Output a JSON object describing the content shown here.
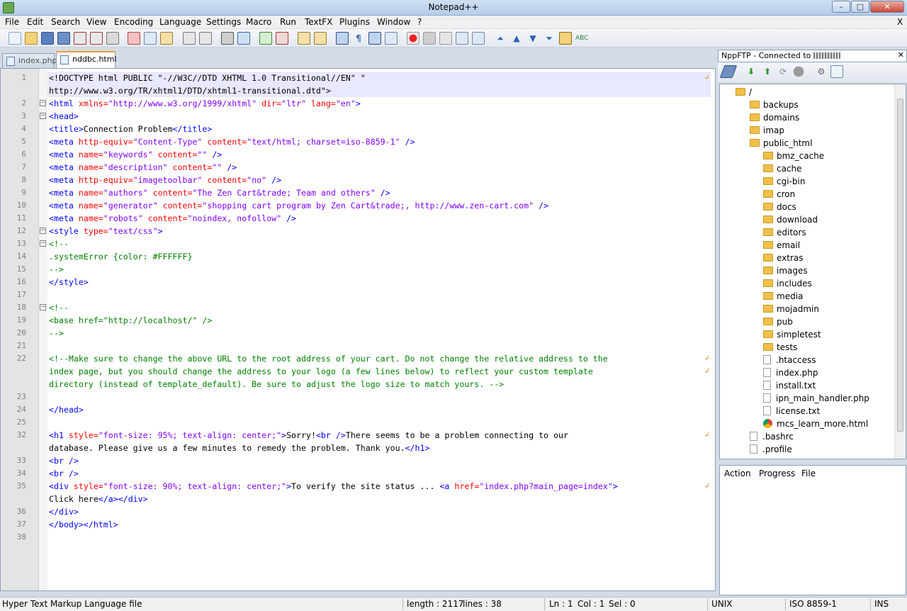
{
  "window": {
    "title": "Notepad++",
    "close_label": "X"
  },
  "menu": [
    "File",
    "Edit",
    "Search",
    "View",
    "Encoding",
    "Language",
    "Settings",
    "Macro",
    "Run",
    "TextFX",
    "Plugins",
    "Window",
    "?"
  ],
  "tabs": [
    {
      "label": "index.php",
      "active": false
    },
    {
      "label": "nddbc.html",
      "active": true
    }
  ],
  "lines": [
    {
      "num": "1",
      "rows": 2,
      "fold": "",
      "segs": [
        [
          "d",
          "<!DOCTYPE html PUBLIC \"-//W3C//DTD XHTML 1.0 Transitional//EN\" \""
        ],
        [
          "d",
          "http://www.w3.org/TR/xhtml1/DTD/xhtml1-transitional.dtd\">"
        ]
      ]
    },
    {
      "num": "2",
      "rows": 1,
      "fold": "-",
      "segs": [
        [
          "t",
          "<html "
        ],
        [
          "a",
          "xmlns="
        ],
        [
          "v",
          "\"http://www.w3.org/1999/xhtml\" "
        ],
        [
          "a",
          "dir="
        ],
        [
          "v",
          "\"ltr\" "
        ],
        [
          "a",
          "lang="
        ],
        [
          "v",
          "\"en\""
        ],
        [
          "t",
          ">"
        ]
      ]
    },
    {
      "num": "3",
      "rows": 1,
      "fold": "-",
      "segs": [
        [
          "t",
          "<head>"
        ]
      ]
    },
    {
      "num": "4",
      "rows": 1,
      "fold": "",
      "segs": [
        [
          "t",
          "<title>"
        ],
        [
          "d",
          "Connection Problem"
        ],
        [
          "t",
          "</title>"
        ]
      ]
    },
    {
      "num": "5",
      "rows": 1,
      "fold": "",
      "segs": [
        [
          "t",
          "<meta "
        ],
        [
          "a",
          "http-equiv="
        ],
        [
          "v",
          "\"Content-Type\" "
        ],
        [
          "a",
          "content="
        ],
        [
          "v",
          "\"text/html; charset=iso-8859-1\" "
        ],
        [
          "t",
          "/>"
        ]
      ]
    },
    {
      "num": "6",
      "rows": 1,
      "fold": "",
      "segs": [
        [
          "t",
          "<meta "
        ],
        [
          "a",
          "name="
        ],
        [
          "v",
          "\"keywords\" "
        ],
        [
          "a",
          "content="
        ],
        [
          "v",
          "\"\" "
        ],
        [
          "t",
          "/>"
        ]
      ]
    },
    {
      "num": "7",
      "rows": 1,
      "fold": "",
      "segs": [
        [
          "t",
          "<meta "
        ],
        [
          "a",
          "name="
        ],
        [
          "v",
          "\"description\" "
        ],
        [
          "a",
          "content="
        ],
        [
          "v",
          "\"\" "
        ],
        [
          "t",
          "/>"
        ]
      ]
    },
    {
      "num": "8",
      "rows": 1,
      "fold": "",
      "segs": [
        [
          "t",
          "<meta "
        ],
        [
          "a",
          "http-equiv="
        ],
        [
          "v",
          "\"imagetoolbar\" "
        ],
        [
          "a",
          "content="
        ],
        [
          "v",
          "\"no\" "
        ],
        [
          "t",
          "/>"
        ]
      ]
    },
    {
      "num": "9",
      "rows": 1,
      "fold": "",
      "segs": [
        [
          "t",
          "<meta "
        ],
        [
          "a",
          "name="
        ],
        [
          "v",
          "\"authors\" "
        ],
        [
          "a",
          "content="
        ],
        [
          "v",
          "\"The Zen Cart&trade; Team and others\" "
        ],
        [
          "t",
          "/>"
        ]
      ]
    },
    {
      "num": "10",
      "rows": 1,
      "fold": "",
      "segs": [
        [
          "t",
          "<meta "
        ],
        [
          "a",
          "name="
        ],
        [
          "v",
          "\"generator\" "
        ],
        [
          "a",
          "content="
        ],
        [
          "v",
          "\"shopping cart program by Zen Cart&trade;, http://www.zen-cart.com\" "
        ],
        [
          "t",
          "/>"
        ]
      ]
    },
    {
      "num": "11",
      "rows": 1,
      "fold": "",
      "segs": [
        [
          "t",
          "<meta "
        ],
        [
          "a",
          "name="
        ],
        [
          "v",
          "\"robots\" "
        ],
        [
          "a",
          "content="
        ],
        [
          "v",
          "\"noindex, nofollow\" "
        ],
        [
          "t",
          "/>"
        ]
      ]
    },
    {
      "num": "12",
      "rows": 1,
      "fold": "-",
      "segs": [
        [
          "t",
          "<style "
        ],
        [
          "a",
          "type="
        ],
        [
          "v",
          "\"text/css\""
        ],
        [
          "t",
          ">"
        ]
      ]
    },
    {
      "num": "13",
      "rows": 1,
      "fold": "-",
      "segs": [
        [
          "c",
          "<!--"
        ]
      ]
    },
    {
      "num": "14",
      "rows": 1,
      "fold": "",
      "segs": [
        [
          "c",
          ".systemError {color: #FFFFFF}"
        ]
      ]
    },
    {
      "num": "15",
      "rows": 1,
      "fold": "",
      "segs": [
        [
          "c",
          "-->"
        ]
      ]
    },
    {
      "num": "16",
      "rows": 1,
      "fold": "",
      "segs": [
        [
          "t",
          "</style>"
        ]
      ]
    },
    {
      "num": "17",
      "rows": 1,
      "fold": "",
      "segs": []
    },
    {
      "num": "18",
      "rows": 1,
      "fold": "-",
      "segs": [
        [
          "c",
          "<!--"
        ]
      ]
    },
    {
      "num": "19",
      "rows": 1,
      "fold": "",
      "segs": [
        [
          "c",
          "<base href=\"http://localhost/\" />"
        ]
      ]
    },
    {
      "num": "20",
      "rows": 1,
      "fold": "",
      "segs": [
        [
          "c",
          "-->"
        ]
      ]
    },
    {
      "num": "21",
      "rows": 1,
      "fold": "",
      "segs": []
    },
    {
      "num": "22",
      "rows": 3,
      "fold": "",
      "segs": [
        [
          "c",
          "<!--Make sure to change the above URL to the root address of your cart. Do not change the relative address to the"
        ],
        [
          "c",
          "index page, but you should change the address to your logo (a few lines below) to reflect your custom template"
        ],
        [
          "c",
          "directory (instead of template_default). Be sure to adjust the logo size to match yours. -->"
        ]
      ]
    },
    {
      "num": "23",
      "rows": 1,
      "fold": "",
      "segs": []
    },
    {
      "num": "24",
      "rows": 1,
      "fold": "",
      "segs": [
        [
          "t",
          "</head>"
        ]
      ]
    },
    {
      "num": "25",
      "rows": 1,
      "fold": "",
      "segs": []
    },
    {
      "num": "32",
      "rows": 2,
      "fold": "",
      "segs": [
        [
          "t",
          "<h1 "
        ],
        [
          "a",
          "style="
        ],
        [
          "v",
          "\"font-size: 95%; text-align: center;\""
        ],
        [
          "t",
          ">"
        ],
        [
          "d",
          "Sorry!"
        ],
        [
          "t",
          "<br />"
        ],
        [
          "d",
          "There seems to be a problem connecting to our"
        ],
        [
          "d",
          "database. Please give us a few minutes to remedy the problem. Thank you."
        ],
        [
          "t",
          "</h1>"
        ]
      ]
    },
    {
      "num": "33",
      "rows": 1,
      "fold": "",
      "segs": [
        [
          "t",
          "<br />"
        ]
      ]
    },
    {
      "num": "34",
      "rows": 1,
      "fold": "",
      "segs": [
        [
          "t",
          "<br />"
        ]
      ]
    },
    {
      "num": "35",
      "rows": 2,
      "fold": "",
      "segs": [
        [
          "t",
          "<div "
        ],
        [
          "a",
          "style="
        ],
        [
          "v",
          "\"font-size: 90%; text-align: center;\""
        ],
        [
          "t",
          ">"
        ],
        [
          "d",
          "To verify the site status ... "
        ],
        [
          "t",
          "<a "
        ],
        [
          "a",
          "href="
        ],
        [
          "v",
          "\"index.php?main_page=index\""
        ],
        [
          "t",
          ">"
        ],
        [
          "d",
          "Click here"
        ],
        [
          "t",
          "</a></div>"
        ]
      ]
    },
    {
      "num": "36",
      "rows": 1,
      "fold": "",
      "segs": [
        [
          "t",
          "</div>"
        ]
      ]
    },
    {
      "num": "37",
      "rows": 1,
      "fold": "",
      "segs": [
        [
          "t",
          "</body></html>"
        ]
      ]
    },
    {
      "num": "38",
      "rows": 1,
      "fold": "",
      "segs": []
    }
  ],
  "ftp": {
    "header": "NppFTP - Connected to",
    "tree": [
      {
        "label": "/",
        "kind": "folder",
        "depth": 0
      },
      {
        "label": "backups",
        "kind": "folder",
        "depth": 1
      },
      {
        "label": "domains",
        "kind": "folder",
        "depth": 1
      },
      {
        "label": "imap",
        "kind": "folder",
        "depth": 1
      },
      {
        "label": "public_html",
        "kind": "folder",
        "depth": 1
      },
      {
        "label": "bmz_cache",
        "kind": "folder",
        "depth": 2
      },
      {
        "label": "cache",
        "kind": "folder",
        "depth": 2
      },
      {
        "label": "cgi-bin",
        "kind": "folder",
        "depth": 2
      },
      {
        "label": "cron",
        "kind": "folder",
        "depth": 2
      },
      {
        "label": "docs",
        "kind": "folder",
        "depth": 2
      },
      {
        "label": "download",
        "kind": "folder",
        "depth": 2
      },
      {
        "label": "editors",
        "kind": "folder",
        "depth": 2
      },
      {
        "label": "email",
        "kind": "folder",
        "depth": 2
      },
      {
        "label": "extras",
        "kind": "folder",
        "depth": 2
      },
      {
        "label": "images",
        "kind": "folder",
        "depth": 2
      },
      {
        "label": "includes",
        "kind": "folder",
        "depth": 2
      },
      {
        "label": "media",
        "kind": "folder",
        "depth": 2
      },
      {
        "label": "mojadmin",
        "kind": "folder",
        "depth": 2
      },
      {
        "label": "pub",
        "kind": "folder",
        "depth": 2
      },
      {
        "label": "simpletest",
        "kind": "folder",
        "depth": 2
      },
      {
        "label": "tests",
        "kind": "folder",
        "depth": 2
      },
      {
        "label": ".htaccess",
        "kind": "file",
        "depth": 2
      },
      {
        "label": "index.php",
        "kind": "file",
        "depth": 2
      },
      {
        "label": "install.txt",
        "kind": "file",
        "depth": 2
      },
      {
        "label": "ipn_main_handler.php",
        "kind": "file",
        "depth": 2
      },
      {
        "label": "license.txt",
        "kind": "file",
        "depth": 2
      },
      {
        "label": "mcs_learn_more.html",
        "kind": "chrome",
        "depth": 2
      },
      {
        "label": ".bashrc",
        "kind": "file",
        "depth": 1
      },
      {
        "label": ".profile",
        "kind": "file",
        "depth": 1
      }
    ],
    "queue_headers": [
      "Action",
      "Progress",
      "File"
    ]
  },
  "status": {
    "filetype": "Hyper Text Markup Language file",
    "length": "length : 2117",
    "lines": "lines : 38",
    "ln": "Ln : 1",
    "col": "Col : 1",
    "sel": "Sel : 0",
    "eol": "UNIX",
    "encoding": "ISO 8859-1",
    "mode": "INS"
  },
  "colors": {
    "tag": "#0000ff",
    "attr": "#ff0000",
    "value": "#8000ff",
    "comment": "#008000",
    "current_line": "#e8e8ff"
  }
}
